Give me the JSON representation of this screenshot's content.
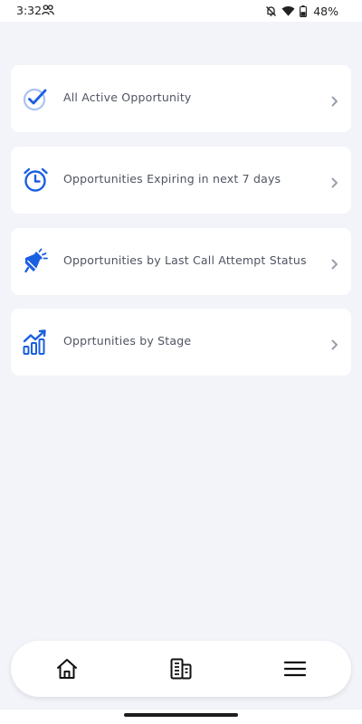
{
  "status_bar": {
    "time": "3:32",
    "battery_percent": "48%",
    "icons": [
      "people-icon",
      "vibrate-off-icon",
      "wifi-icon",
      "battery-icon"
    ]
  },
  "menu": {
    "items": [
      {
        "label": "All Active Opportunity",
        "icon": "check-circle-icon"
      },
      {
        "label": "Opportunities Expiring in next 7 days",
        "icon": "alarm-clock-icon"
      },
      {
        "label": "Opportunities by Last Call Attempt Status",
        "icon": "megaphone-icon"
      },
      {
        "label": "Opprtunities by Stage",
        "icon": "bar-chart-trend-icon"
      }
    ]
  },
  "bottom_nav": {
    "items": [
      {
        "icon": "home-icon"
      },
      {
        "icon": "buildings-icon"
      },
      {
        "icon": "hamburger-menu-icon"
      }
    ]
  },
  "colors": {
    "background": "#f3f4fa",
    "card": "#ffffff",
    "accent_blue": "#1a5fe0",
    "label_text": "#4f5462",
    "chevron": "#9aa0aa"
  }
}
